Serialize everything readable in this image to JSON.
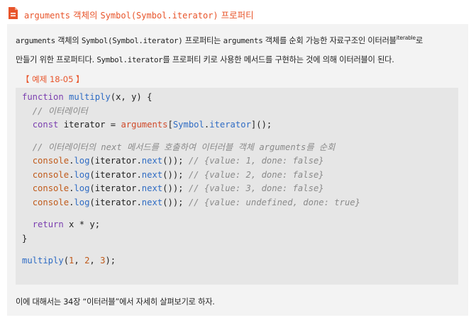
{
  "header": {
    "icon": "document-icon",
    "title_prefix": "arguments",
    "title_mid": " 객체의 ",
    "title_code": "Symbol(Symbol.iterator)",
    "title_suffix": " 프로퍼티",
    "accent_color": "#e8542a"
  },
  "paragraph": {
    "t1": "arguments",
    "t2": " 객체의 ",
    "t3": "Symbol(Symbol.iterator)",
    "t4": " 프로퍼티는 ",
    "t5": "arguments",
    "t6": " 객체를 순회 가능한 자료구조인 이터러블",
    "sup": "iterable",
    "t7": "로",
    "t8": "만들기 위한 프로퍼티다. ",
    "t9": "Symbol.iterator",
    "t10": "를 프로퍼티 키로 사용한 메서드를 구현하는 것에 의해 이터러블이 된다."
  },
  "example": {
    "label": "【 예제 18-05 】"
  },
  "code": {
    "l1_kw": "function",
    "l1_fn": "multiply",
    "l1_rest": "(x, y) {",
    "l2_cm": "// 이터레이터",
    "l3_kw": "const",
    "l3_mid": " iterator = ",
    "l3_arg": "arguments",
    "l3_b1": "[",
    "l3_sym": "Symbol",
    "l3_dot": ".",
    "l3_it": "iterator",
    "l3_end": "]();",
    "l4_cm": "// 이터레이터의 next 메서드를 호출하여 이터러블 객체 arguments를 순회",
    "console": "console",
    "log": "log",
    "call_mid": "(iterator.",
    "next": "next",
    "call_end": "()); ",
    "r1": "// {value: 1, done: false}",
    "r2": "// {value: 2, done: false}",
    "r3": "// {value: 3, done: false}",
    "r4": "// {value: undefined, done: true}",
    "ret_kw": "return",
    "ret_rest": " x * y;",
    "close": "}",
    "call_fn": "multiply",
    "call_open": "(",
    "n1": "1",
    "comma": ", ",
    "n2": "2",
    "n3": "3",
    "call_close": ");"
  },
  "footer": {
    "text": "이에 대해서는 34장 “이터러블”에서 자세히 살펴보기로 하자."
  }
}
